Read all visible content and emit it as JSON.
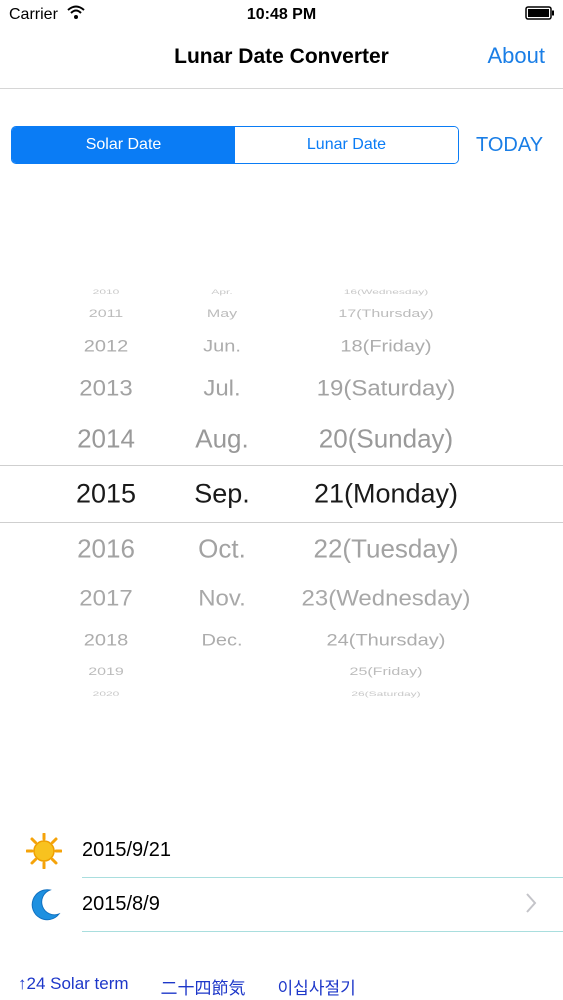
{
  "status_bar": {
    "carrier": "Carrier",
    "time": "10:48 PM"
  },
  "nav": {
    "title": "Lunar Date Converter",
    "about": "About"
  },
  "segment": {
    "solar": "Solar Date",
    "lunar": "Lunar Date",
    "selected": "solar"
  },
  "today_button": "TODAY",
  "picker": {
    "years": [
      "2010",
      "2011",
      "2012",
      "2013",
      "2014",
      "2015",
      "2016",
      "2017",
      "2018",
      "2019",
      "2020"
    ],
    "months": [
      "Apr.",
      "May",
      "Jun.",
      "Jul.",
      "Aug.",
      "Sep.",
      "Oct.",
      "Nov.",
      "Dec.",
      "",
      ""
    ],
    "days": [
      "16(Wednesday)",
      "17(Thursday)",
      "18(Friday)",
      "19(Saturday)",
      "20(Sunday)",
      "21(Monday)",
      "22(Tuesday)",
      "23(Wednesday)",
      "24(Thursday)",
      "25(Friday)",
      "26(Saturday)"
    ],
    "selected_index": 5
  },
  "solar_result": {
    "icon": "sun-icon",
    "date": "2015/9/21"
  },
  "lunar_result": {
    "icon": "moon-icon",
    "date": "2015/8/9"
  },
  "bottom_links": [
    "↑24 Solar term",
    "二十四節気",
    "이십사절기"
  ],
  "colors": {
    "accent": "#0a7cf5",
    "link": "#1d37c9",
    "separator": "#a9dede"
  }
}
